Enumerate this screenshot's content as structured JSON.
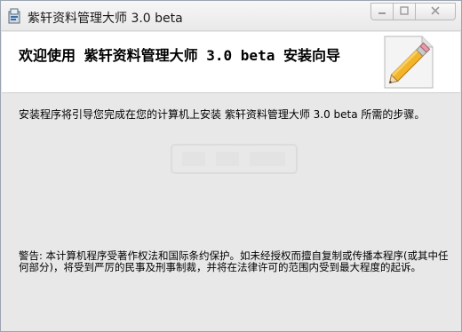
{
  "window": {
    "title": "紫轩资料管理大师 3.0 beta",
    "controls": {
      "minimize": "—",
      "maximize": "□",
      "close": "✕"
    }
  },
  "header": {
    "title": "欢迎使用 紫轩资料管理大师 3.0 beta 安装向导"
  },
  "main": {
    "intro": "安装程序将引导您完成在您的计算机上安装 紫轩资料管理大师 3.0 beta 所需的步骤。",
    "warning": "警告: 本计算机程序受著作权法和国际条约保护。如未经授权而擅自复制或传播本程序(或其中任何部分)，将受到严厉的民事及刑事制裁，并将在法律许可的范围内受到最大程度的起诉。"
  },
  "icons": {
    "app": "installer-icon",
    "header_art": "pencil-paper-icon"
  }
}
